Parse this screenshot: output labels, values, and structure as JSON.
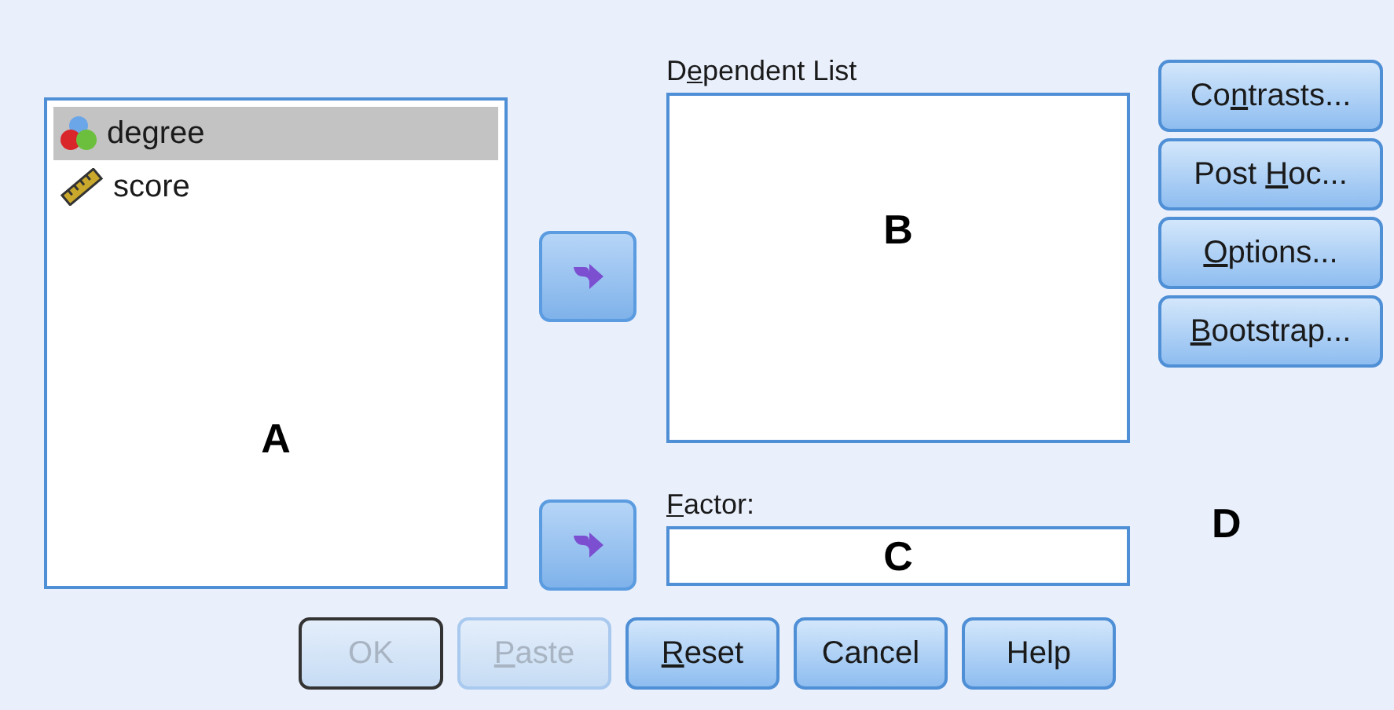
{
  "variables": [
    {
      "name": "degree",
      "kind": "nominal",
      "selected": true
    },
    {
      "name": "score",
      "kind": "scale",
      "selected": false
    }
  ],
  "source_annotation": "A",
  "move_buttons": [
    {
      "kind": "arrow"
    },
    {
      "kind": "arrow"
    }
  ],
  "dependent_list": {
    "label": {
      "pre": "D",
      "key": "e",
      "post": "pendent List"
    },
    "annotation": "B"
  },
  "factor": {
    "label": {
      "key": "F",
      "post": "actor:"
    },
    "annotation": "C"
  },
  "side_buttons": [
    {
      "label": {
        "pre": "Co",
        "key": "n",
        "post": "trasts..."
      }
    },
    {
      "label": {
        "pre": "Post ",
        "key": "H",
        "post": "oc..."
      }
    },
    {
      "label": {
        "key": "O",
        "post": "ptions..."
      }
    },
    {
      "label": {
        "key": "B",
        "post": "ootstrap..."
      }
    }
  ],
  "side_annotation": "D",
  "bottom_buttons": [
    {
      "label": {
        "post": "OK"
      },
      "disabled": true,
      "default": true
    },
    {
      "label": {
        "key": "P",
        "post": "aste"
      },
      "disabled": true,
      "default": false
    },
    {
      "label": {
        "key": "R",
        "post": "eset"
      },
      "disabled": false,
      "default": false
    },
    {
      "label": {
        "post": "Cancel"
      },
      "disabled": false,
      "default": false
    },
    {
      "label": {
        "post": "Help"
      },
      "disabled": false,
      "default": false
    }
  ]
}
